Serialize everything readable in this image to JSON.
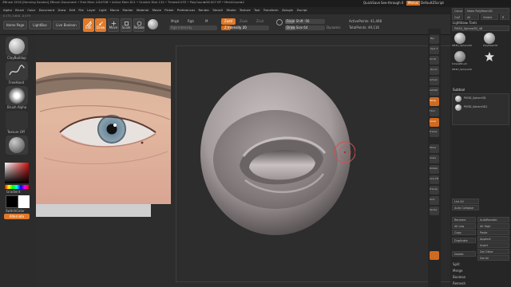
{
  "title_bar": {
    "app_title": "ZBrush 2018 [Henning Sanden]   ZBrush Document   • Free Mem 4.847GB • Active Mem 811 • Scratch Disk 134 • Timer▸0.033 • PolyCount▸56.007 KP • MeshCount▸2",
    "quicksave": "QuickSave",
    "see_through": "See-through 0",
    "menus_btn": "Menus",
    "script": "DefaultZScript"
  },
  "menu_bar": [
    "Alpha",
    "Brush",
    "Color",
    "Document",
    "Draw",
    "Edit",
    "File",
    "Layer",
    "Light",
    "Macro",
    "Marker",
    "Material",
    "Movie",
    "Picker",
    "Preferences",
    "Render",
    "Stencil",
    "Stroke",
    "Texture",
    "Tool",
    "Transform",
    "Zplugin",
    "Zscript"
  ],
  "coords_readout": "0.175, 0.618, -0.479",
  "toolbar": {
    "home_page": "Home Page",
    "lightbox": "LightBox",
    "live_boolean": "Live Boolean",
    "edit": "Edit",
    "draw": "Draw",
    "move": "Move",
    "scale": "Scale",
    "rotate": "Rotate",
    "mrgb": "Mrgb",
    "rgb": "Rgb",
    "m": "M",
    "rgb_intensity": "Rgb Intensity",
    "zadd": "Zadd",
    "zsub": "Zsub",
    "zcut": "Zcut",
    "z_intensity": "Z Intensity 20",
    "focal_shift": "Focal Shift -56",
    "draw_size": "Draw Size 64",
    "dynamic": "Dynamic",
    "active_points": "ActivePoints: 41,408",
    "total_points": "TotalPoints: 49,116",
    "z_intensity_level": 0.2,
    "focal_shift_level": 0.22,
    "draw_size_level": 0.25
  },
  "left_shelf": {
    "brush": "ClayBuildup",
    "stroke": "FreeHand",
    "alpha": "Brush Alpha",
    "texture": "Texture Off",
    "material": "MatCap",
    "gradient": "Gradient",
    "switch_color": "SwitchColor",
    "alternate": "Alternate"
  },
  "right_tray": {
    "clone": "Clone",
    "make_polymesh": "Make PolyMesh3D",
    "goz": "GoZ",
    "all": "All",
    "visible": "Visible",
    "r": "R",
    "lightbox_tools": "Lightbox▸ Tools",
    "current_tool": "PM3D_Sphere3D_48",
    "tool_thumbs": [
      "PM3D_Sphere3D",
      "PolyMesh3D",
      "SimpleBrush",
      "PM3D_Sphere3D"
    ],
    "subtool": "Subtool",
    "subtool_items": [
      "PM3D_Sphere3D",
      "PM3D_Sphere3D1"
    ],
    "list_all": "List All",
    "auto_collapse": "Auto Collapse",
    "rename": "Rename",
    "autoreorder": "AutoReorder",
    "all_low": "All Low",
    "all_high": "All High",
    "copy": "Copy",
    "paste": "Paste",
    "duplicate": "Duplicate",
    "append": "Append",
    "insert": "Insert",
    "delete": "Delete",
    "del_other": "Del Other",
    "del_all": "Del All",
    "split": "Split",
    "merge": "Merge",
    "boolean": "Boolean",
    "remesh": "Remesh"
  },
  "right_shelf": [
    "Bpr",
    "Spix 3",
    "Scroll",
    "Zoom",
    "Actual",
    "AAHalf",
    "Persp",
    "Floor",
    "Local",
    "Frame",
    "Move",
    "Scale",
    "Rotate",
    "Line Fill",
    "Transp",
    "Solo",
    "Xpose"
  ]
}
